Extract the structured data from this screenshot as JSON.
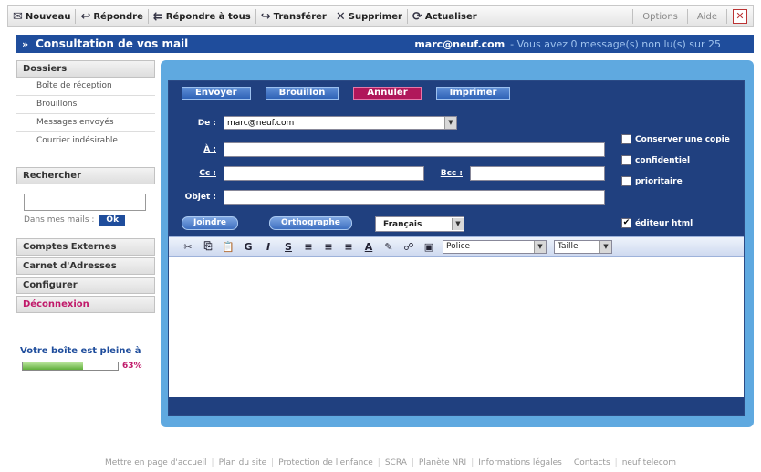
{
  "toolbar": {
    "buttons": [
      {
        "label": "Nouveau",
        "icon": "new-message-icon"
      },
      {
        "label": "Répondre",
        "icon": "reply-icon"
      },
      {
        "label": "Répondre à tous",
        "icon": "reply-all-icon"
      },
      {
        "label": "Transférer",
        "icon": "forward-icon"
      },
      {
        "label": "Supprimer",
        "icon": "delete-icon"
      },
      {
        "label": "Actualiser",
        "icon": "refresh-icon"
      }
    ],
    "options": "Options",
    "aide": "Aide",
    "close": "✕"
  },
  "header": {
    "arrow": "»",
    "title": "Consultation de vos mail",
    "email": "marc@neuf.com",
    "message": "- Vous avez 0 message(s) non lu(s) sur 25"
  },
  "sidebar": {
    "dossiers_title": "Dossiers",
    "folders": [
      "Boîte de réception",
      "Brouillons",
      "Messages envoyés",
      "Courrier indésirable"
    ],
    "search_title": "Rechercher",
    "search_scope": "Dans mes mails :",
    "search_ok": "Ok",
    "links": [
      "Comptes Externes",
      "Carnet d'Adresses",
      "Configurer"
    ],
    "logout": "Déconnexion",
    "quota_text": "Votre boîte est pleine à",
    "quota_percent": "63%",
    "quota_fraction": 0.63
  },
  "compose": {
    "actions": {
      "send": "Envoyer",
      "draft": "Brouillon",
      "cancel": "Annuler",
      "print": "Imprimer"
    },
    "from_label": "De :",
    "from_value": "marc@neuf.com",
    "to_label": "À :",
    "cc_label": "Cc :",
    "bcc_label": "Bcc :",
    "subject_label": "Objet :",
    "options": [
      {
        "label": "Conserver une copie",
        "checked": false
      },
      {
        "label": "confidentiel",
        "checked": false
      },
      {
        "label": "prioritaire",
        "checked": false
      }
    ],
    "html_editor": {
      "label": "éditeur html",
      "checked": true
    },
    "attach": "Joindre",
    "spellcheck": "Orthographe",
    "language": "Français",
    "font": "Police",
    "size": "Taille"
  },
  "footer": {
    "links": [
      "Mettre en page d'accueil",
      "Plan du site",
      "Protection de l'enfance",
      "SCRA",
      "Planète NRI",
      "Informations légales",
      "Contacts",
      "neuf telecom"
    ]
  }
}
